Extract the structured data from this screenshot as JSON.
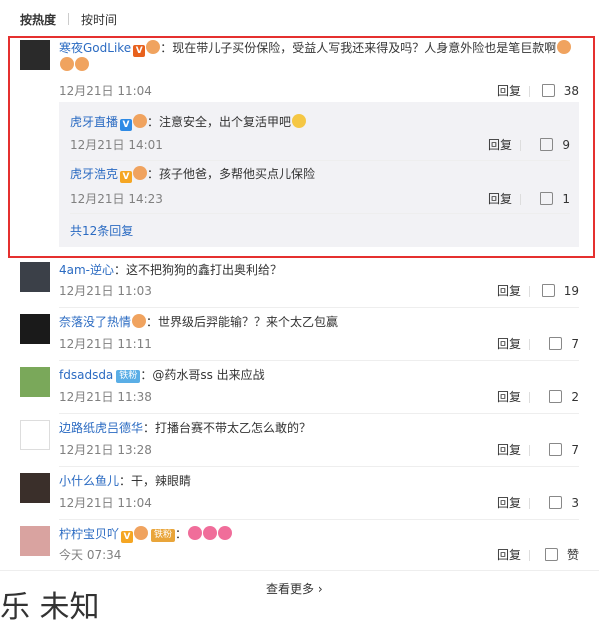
{
  "sort": {
    "by_hot": "按热度",
    "by_time": "按时间"
  },
  "main_comment": {
    "username": "寒夜GodLike",
    "text": "：现在带儿子买份保险，受益人写我还来得及吗？人身意外险也是笔巨款啊",
    "time": "12月21日 11:04",
    "reply": "回复",
    "likes": "38",
    "replies": [
      {
        "username": "虎牙直播",
        "text": "：注意安全，出个复活甲吧",
        "time": "12月21日 14:01",
        "reply": "回复",
        "likes": "9"
      },
      {
        "username": "虎牙浩克",
        "text": "：孩子他爸，多帮他买点儿保险",
        "time": "12月21日 14:23",
        "reply": "回复",
        "likes": "1"
      }
    ],
    "more_replies": "共12条回复"
  },
  "comments": [
    {
      "username": "4am-逆心",
      "text": "：这不把狗狗的鑫打出奥利给？",
      "time": "12月21日 11:03",
      "reply": "回复",
      "likes": "19"
    },
    {
      "username": "奈落没了热情",
      "text": "：世界级后羿能输？？来个太乙包赢",
      "time": "12月21日 11:11",
      "reply": "回复",
      "likes": "7"
    },
    {
      "username": "fdsadsda",
      "fan": "铁粉",
      "text": "：@药水哥ss 出来应战",
      "time": "12月21日 11:38",
      "reply": "回复",
      "likes": "2"
    },
    {
      "username": "边路纸虎吕德华",
      "text": "：打播台赛不带太乙怎么敢的？",
      "time": "12月21日 13:28",
      "reply": "回复",
      "likes": "7"
    },
    {
      "username": "小什么鱼儿",
      "text": "：干，辣眼睛",
      "time": "12月21日 11:04",
      "reply": "回复",
      "likes": "3"
    },
    {
      "username": "柠柠宝贝吖",
      "fan": "铁粉",
      "text": "：",
      "time": "今天 07:34",
      "reply": "回复",
      "likes": "赞"
    }
  ],
  "see_more": "查看更多 ›",
  "bottom_partial_text": "乐  未知"
}
